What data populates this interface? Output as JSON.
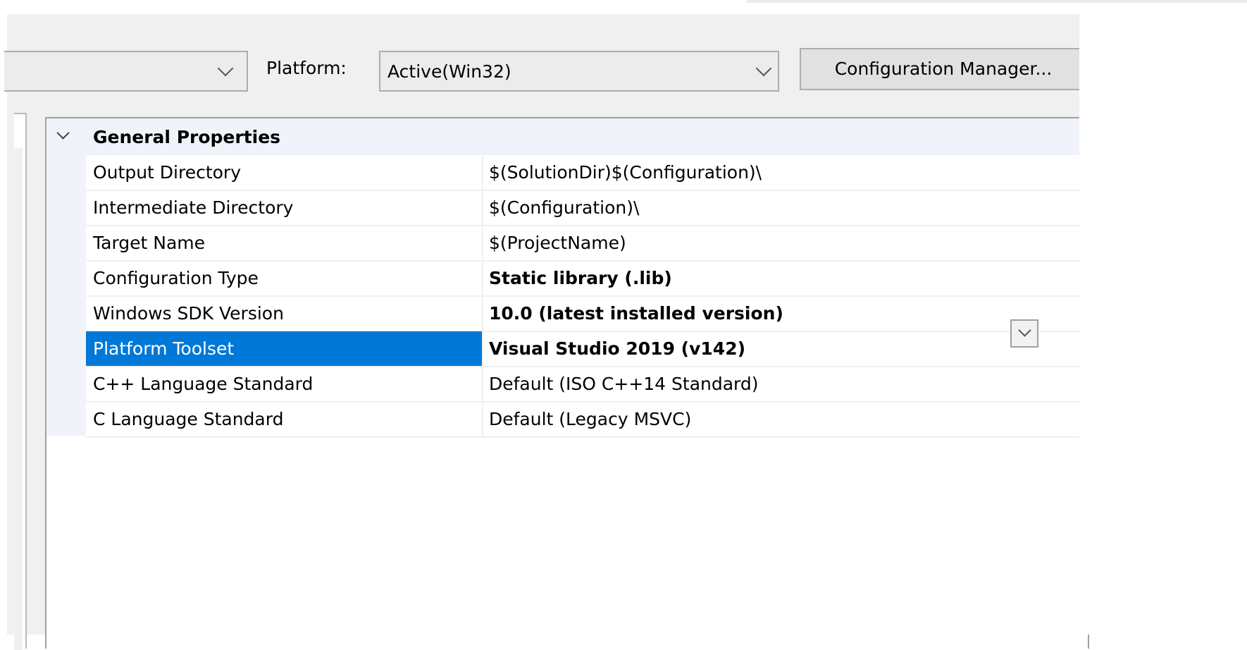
{
  "toolbar": {
    "configuration_value": "",
    "platform_label": "Platform:",
    "platform_value": "Active(Win32)",
    "config_manager_label": "Configuration Manager..."
  },
  "grid": {
    "category": "General Properties",
    "selected_property": "Platform Toolset",
    "properties": [
      {
        "name": "Output Directory",
        "value": "$(SolutionDir)$(Configuration)\\",
        "bold": false
      },
      {
        "name": "Intermediate Directory",
        "value": "$(Configuration)\\",
        "bold": false
      },
      {
        "name": "Target Name",
        "value": "$(ProjectName)",
        "bold": false
      },
      {
        "name": "Configuration Type",
        "value": "Static library (.lib)",
        "bold": true
      },
      {
        "name": "Windows SDK Version",
        "value": "10.0 (latest installed version)",
        "bold": true
      },
      {
        "name": "Platform Toolset",
        "value": "Visual Studio 2019 (v142)",
        "bold": true
      },
      {
        "name": "C++ Language Standard",
        "value": "Default (ISO C++14 Standard)",
        "bold": false
      },
      {
        "name": "C Language Standard",
        "value": "Default (Legacy MSVC)",
        "bold": false
      }
    ]
  },
  "colors": {
    "selection": "#0078d7",
    "dialog_bg": "#f0f0f0",
    "category_bg": "#f0f4fa"
  },
  "icons": {
    "category_toggle": "chevron-down-icon",
    "combo_arrow": "chevron-down-icon"
  }
}
